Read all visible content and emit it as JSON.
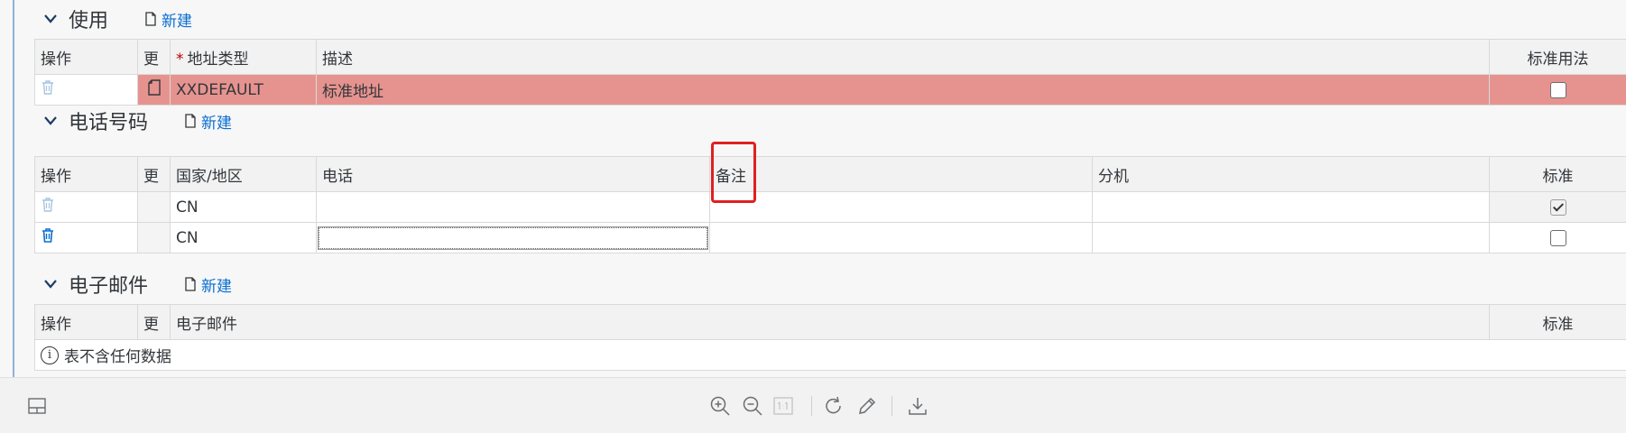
{
  "sections": {
    "usage": {
      "title": "使用",
      "new_label": "新建"
    },
    "phone": {
      "title": "电话号码",
      "new_label": "新建"
    },
    "email": {
      "title": "电子邮件",
      "new_label": "新建"
    }
  },
  "usage_table": {
    "headers": {
      "action": "操作",
      "change": "更",
      "address_type": "地址类型",
      "description": "描述",
      "standard_usage": "标准用法"
    },
    "rows": [
      {
        "address_type": "XXDEFAULT",
        "description": "标准地址",
        "standard_usage": false
      }
    ]
  },
  "phone_table": {
    "headers": {
      "action": "操作",
      "change": "更",
      "country": "国家/地区",
      "phone": "电话",
      "note": "备注",
      "extension": "分机",
      "standard": "标准"
    },
    "rows": [
      {
        "country": "CN",
        "phone": "",
        "note": "",
        "extension": "",
        "standard": true
      },
      {
        "country": "CN",
        "phone": "",
        "note": "",
        "extension": "",
        "standard": false
      }
    ]
  },
  "email_table": {
    "headers": {
      "action": "操作",
      "change": "更",
      "email": "电子邮件",
      "standard": "标准"
    },
    "empty_text": "表不含任何数据"
  },
  "colors": {
    "highlight_row": "#e6938f",
    "link": "#0a6ed1",
    "annotation": "#e02020"
  },
  "toolbar_icons": [
    "layout-icon",
    "zoom-in-icon",
    "zoom-out-icon",
    "actual-size-icon",
    "rotate-icon",
    "edit-pen-icon",
    "download-icon"
  ]
}
